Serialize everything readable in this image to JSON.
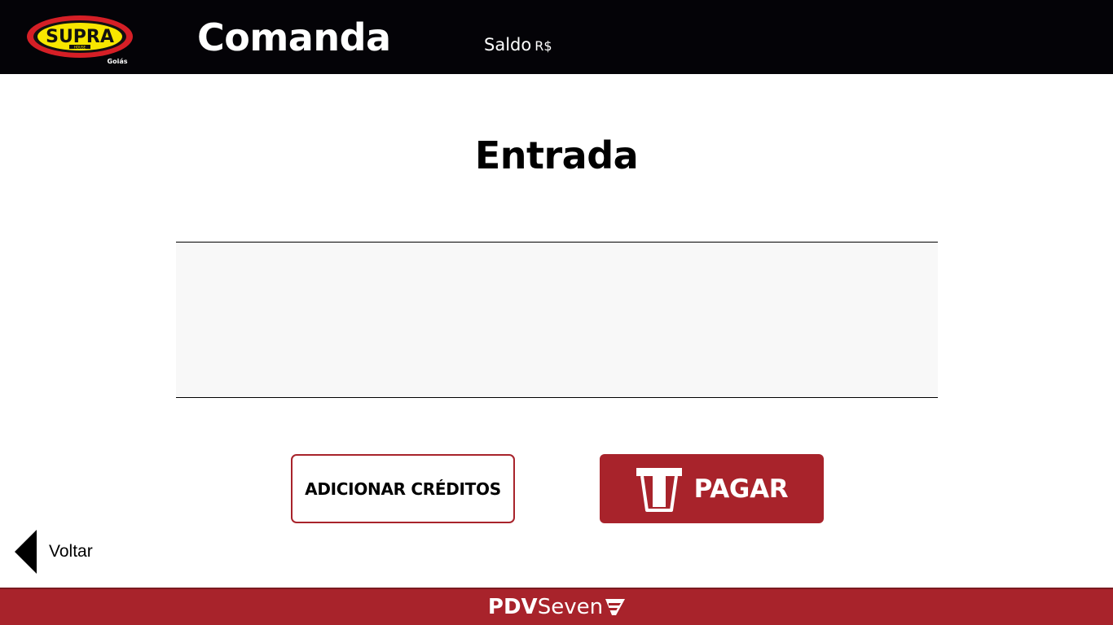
{
  "header": {
    "logo_text": "SUPRA",
    "logo_subtext": "HOUSE",
    "logo_region": "Goiás",
    "title": "Comanda",
    "balance_label": "Saldo",
    "balance_currency": "R$"
  },
  "main": {
    "title": "Entrada",
    "entry_value": ""
  },
  "actions": {
    "add_credits_label": "ADICIONAR CRÉDITOS",
    "pay_label": "PAGAR",
    "pay_icon": "card-terminal-icon"
  },
  "nav": {
    "back_label": "Voltar",
    "back_icon": "back-arrow-icon"
  },
  "footer": {
    "brand_bold": "PDV",
    "brand_regular": "Seven",
    "brand_icon": "seven-stripes-icon"
  },
  "colors": {
    "header_bg": "#040307",
    "accent_red": "#a8232b",
    "entry_bg": "#f8f8f8",
    "logo_yellow": "#f7e600"
  }
}
